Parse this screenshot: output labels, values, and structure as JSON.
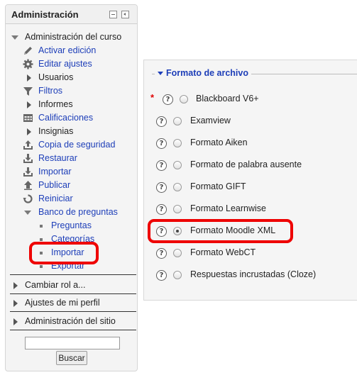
{
  "admin": {
    "title": "Administración",
    "course_admin": "Administración del curso",
    "items": [
      {
        "label": "Activar edición",
        "icon": "pencil-icon",
        "link": true
      },
      {
        "label": "Editar ajustes",
        "icon": "gear-icon",
        "link": true
      },
      {
        "label": "Usuarios",
        "icon": "expand-arrow-icon",
        "link": false
      },
      {
        "label": "Filtros",
        "icon": "filter-icon",
        "link": true
      },
      {
        "label": "Informes",
        "icon": "expand-arrow-icon",
        "link": false
      },
      {
        "label": "Calificaciones",
        "icon": "grades-table-icon",
        "link": true
      },
      {
        "label": "Insignias",
        "icon": "expand-arrow-icon",
        "link": false
      },
      {
        "label": "Copia de seguridad",
        "icon": "backup-upload-icon",
        "link": true
      },
      {
        "label": "Restaurar",
        "icon": "restore-download-icon",
        "link": true
      },
      {
        "label": "Importar",
        "icon": "import-icon",
        "link": true
      },
      {
        "label": "Publicar",
        "icon": "publish-icon",
        "link": true
      },
      {
        "label": "Reiniciar",
        "icon": "reset-icon",
        "link": true
      }
    ],
    "question_bank": {
      "label": "Banco de preguntas",
      "sub": [
        "Preguntas",
        "Categorías",
        "Importar",
        "Exportar"
      ]
    },
    "switch_role": "Cambiar rol a...",
    "profile": "Ajustes de mi perfil",
    "site_admin": "Administración del sitio",
    "search_value": "",
    "search_button": "Buscar"
  },
  "format": {
    "legend": "Formato de archivo",
    "options": [
      {
        "label": "Blackboard V6+",
        "selected": false,
        "required": true
      },
      {
        "label": "Examview",
        "selected": false
      },
      {
        "label": "Formato Aiken",
        "selected": false
      },
      {
        "label": "Formato de palabra ausente",
        "selected": false
      },
      {
        "label": "Formato GIFT",
        "selected": false
      },
      {
        "label": "Formato Learnwise",
        "selected": false
      },
      {
        "label": "Formato Moodle XML",
        "selected": true
      },
      {
        "label": "Formato WebCT",
        "selected": false
      },
      {
        "label": "Respuestas incrustadas (Cloze)",
        "selected": false
      }
    ],
    "required_mark": "*",
    "help_glyph": "?"
  },
  "colors": {
    "link": "#1d3eb8",
    "highlight": "#ee0000",
    "required": "#e00000"
  }
}
